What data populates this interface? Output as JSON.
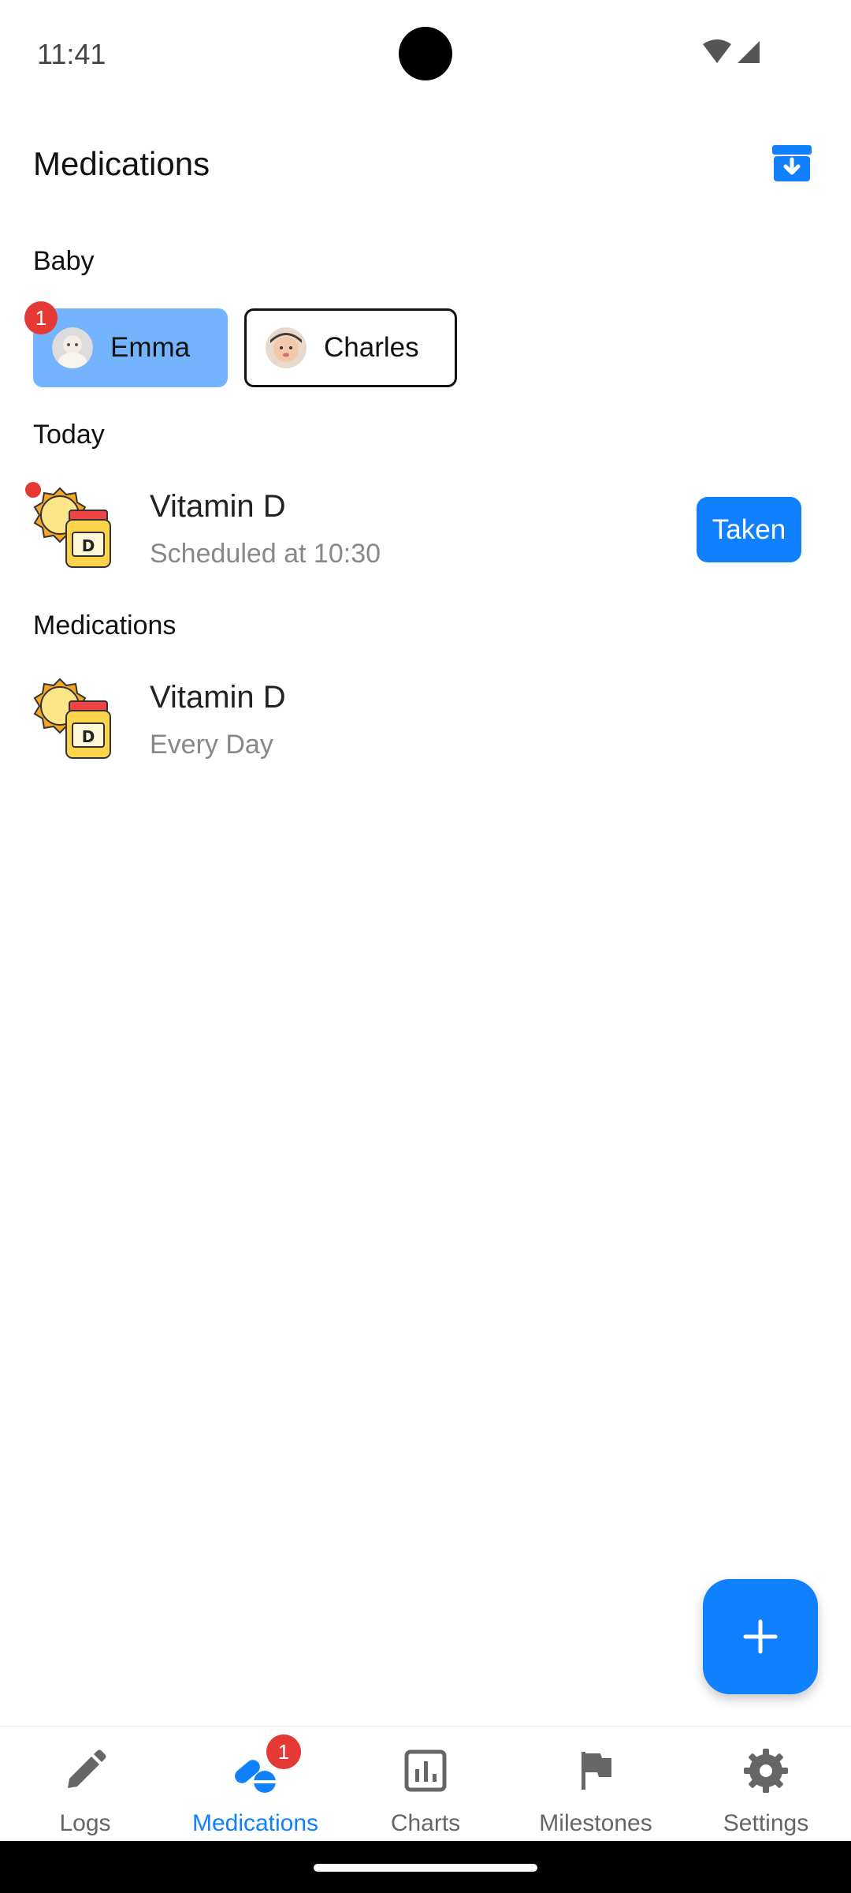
{
  "status_bar": {
    "time": "11:41"
  },
  "header": {
    "title": "Medications"
  },
  "baby": {
    "label": "Baby",
    "chips": [
      {
        "name": "Emma",
        "badge": "1",
        "selected": true
      },
      {
        "name": "Charles",
        "selected": false
      }
    ]
  },
  "today": {
    "label": "Today",
    "items": [
      {
        "name": "Vitamin D",
        "subtitle": "Scheduled at 10:30",
        "action_label": "Taken"
      }
    ]
  },
  "medications": {
    "label": "Medications",
    "items": [
      {
        "name": "Vitamin D",
        "subtitle": "Every Day"
      }
    ]
  },
  "bottom_nav": {
    "items": [
      {
        "label": "Logs",
        "icon": "pencil-icon"
      },
      {
        "label": "Medications",
        "icon": "pills-icon",
        "badge": "1",
        "active": true
      },
      {
        "label": "Charts",
        "icon": "chart-icon"
      },
      {
        "label": "Milestones",
        "icon": "flag-icon"
      },
      {
        "label": "Settings",
        "icon": "gear-icon"
      }
    ]
  },
  "colors": {
    "accent": "#1180ff",
    "chip_selected": "#74b4ff",
    "badge": "#e53935"
  }
}
